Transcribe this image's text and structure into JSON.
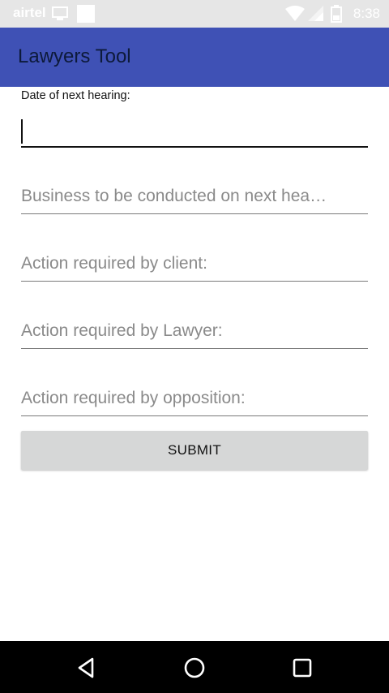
{
  "status_bar": {
    "carrier": "airtel",
    "time": "8:38",
    "icons": [
      "notification-icon",
      "square-icon",
      "wifi-icon",
      "signal-icon",
      "battery-icon"
    ]
  },
  "app_bar": {
    "title": "Lawyers Tool",
    "color": "#3f51b5"
  },
  "form": {
    "date_label": "Date of next hearing:",
    "date_value": "",
    "fields": [
      {
        "placeholder": "Business to be conducted on next hea…",
        "value": ""
      },
      {
        "placeholder": "Action required by client:",
        "value": ""
      },
      {
        "placeholder": "Action required by Lawyer:",
        "value": ""
      },
      {
        "placeholder": "Action required by opposition:",
        "value": ""
      }
    ],
    "submit_label": "SUBMIT"
  },
  "nav_bar": {
    "buttons": [
      "back-icon",
      "home-icon",
      "recents-icon"
    ]
  }
}
